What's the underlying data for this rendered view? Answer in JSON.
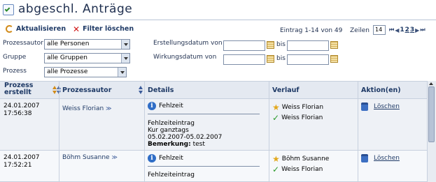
{
  "title": "abgeschl. Anträge",
  "toolbar": {
    "refresh_label": "Aktualisieren",
    "clear_filter_label": "Filter löschen",
    "range_text": "Eintrag 1-14 von 49",
    "rows_label": "Zeilen",
    "rows_value": "14",
    "pages": [
      "1",
      "2",
      "3"
    ],
    "nav_first": "⏮",
    "nav_prev": "◀",
    "nav_next": "▶",
    "nav_last": "⏭"
  },
  "filters": {
    "author_label": "Prozessautor",
    "author_value": "alle Personen",
    "group_label": "Gruppe",
    "group_value": "alle Gruppen",
    "process_label": "Prozess",
    "process_value": "alle Prozesse",
    "created_label": "Erstellungsdatum von",
    "effective_label": "Wirkungsdatum von",
    "bis_label": "bis"
  },
  "table": {
    "headers": {
      "created": "Prozess erstellt",
      "author": "Prozessautor",
      "details": "Details",
      "history": "Verlauf",
      "actions": "Aktion(en)"
    },
    "rows": [
      {
        "date": "24.01.2007",
        "time": "17:56:38",
        "author": "Weiss Florian",
        "detail_title": "Fehlzeit",
        "detail_lines": [
          "Fehlzeiteintrag",
          "Kur ganztags",
          "05.02.2007-05.02.2007"
        ],
        "remark_label": "Bemerkung:",
        "remark_value": "test",
        "history": [
          "Weiss Florian",
          "Weiss Florian"
        ],
        "action": "Löschen"
      },
      {
        "date": "24.01.2007",
        "time": "17:52:21",
        "author": "Böhm Susanne",
        "detail_title": "Fehlzeit",
        "detail_lines": [
          "Fehlzeiteintrag"
        ],
        "history": [
          "Böhm Susanne",
          "Weiss Florian"
        ],
        "action": "Löschen"
      }
    ]
  },
  "colors": {
    "accent": "#1f3a66",
    "header_bg": "#e4e9f1",
    "row_bg": "#eef1f6"
  }
}
